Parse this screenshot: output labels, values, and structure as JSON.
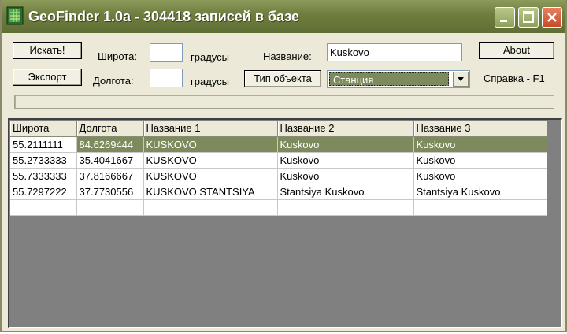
{
  "window": {
    "title": "GeoFinder 1.0a -  304418 записей в базе"
  },
  "toolbar": {
    "search_label": "Искать!",
    "export_label": "Экспорт",
    "about_label": "About",
    "help_text": "Справка - F1",
    "latitude_label": "Широта:",
    "longitude_label": "Долгота:",
    "degrees_label": "градусы",
    "name_label": "Название:",
    "name_value": "Kuskovo",
    "latitude_value": "",
    "longitude_value": "",
    "object_type_label": "Тип объекта",
    "object_type_value": "Станция"
  },
  "grid": {
    "columns": [
      "Широта",
      "Долгота",
      "Название 1",
      "Название 2",
      "Название 3"
    ],
    "rows": [
      [
        "55.2111111",
        "84.6269444",
        "KUSKOVO",
        "Kuskovo",
        "Kuskovo"
      ],
      [
        "55.2733333",
        "35.4041667",
        "KUSKOVO",
        "Kuskovo",
        "Kuskovo"
      ],
      [
        "55.7333333",
        "37.8166667",
        "KUSKOVO",
        "Kuskovo",
        "Kuskovo"
      ],
      [
        "55.7297222",
        "37.7730556",
        "KUSKOVO STANTSIYA",
        "Stantsiya Kuskovo",
        "Stantsiya Kuskovo"
      ],
      [
        "",
        "",
        "",
        "",
        ""
      ]
    ],
    "selected_row": 0
  },
  "colors": {
    "title_bar": "#6e7d3e",
    "selection": "#7d8a5c",
    "grid_background": "#808080",
    "window_face": "#ece9d8"
  }
}
